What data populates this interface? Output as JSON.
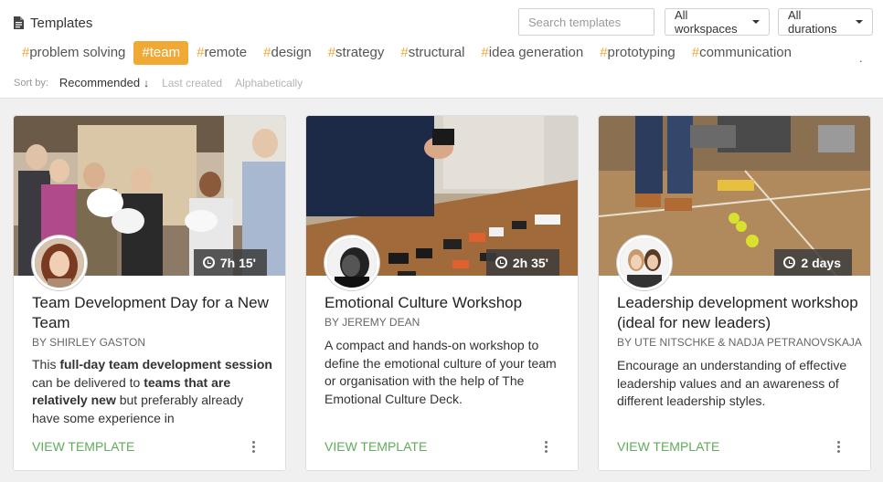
{
  "header": {
    "title": "Templates",
    "search_placeholder": "Search templates",
    "workspace_filter": "All workspaces",
    "duration_filter": "All durations"
  },
  "tags": [
    {
      "label": "problem solving",
      "active": false
    },
    {
      "label": "team",
      "active": true
    },
    {
      "label": "remote",
      "active": false
    },
    {
      "label": "design",
      "active": false
    },
    {
      "label": "strategy",
      "active": false
    },
    {
      "label": "structural",
      "active": false
    },
    {
      "label": "idea generation",
      "active": false
    },
    {
      "label": "prototyping",
      "active": false
    },
    {
      "label": "communication",
      "active": false
    }
  ],
  "tags_overflow": ".",
  "sort": {
    "label": "Sort by:",
    "options": [
      "Recommended",
      "Last created",
      "Alphabetically"
    ],
    "active": "Recommended",
    "direction_icon": "arrow-down-icon"
  },
  "colors": {
    "accent": "#f0a934",
    "link": "#5fac5b",
    "duration_badge": "#3c3c3c"
  },
  "cards": [
    {
      "title": "Team Development Day for a New Team",
      "author": "BY SHIRLEY GASTON",
      "duration": "7h 15'",
      "description_parts": [
        {
          "text": "This ",
          "bold": false
        },
        {
          "text": "full-day team development session",
          "bold": true
        },
        {
          "text": " can be delivered to ",
          "bold": false
        },
        {
          "text": "teams that are relatively new",
          "bold": true
        },
        {
          "text": " but preferably already have some experience in",
          "bold": false
        }
      ],
      "action": "VIEW TEMPLATE"
    },
    {
      "title": "Emotional Culture Workshop",
      "author": "BY JEREMY DEAN",
      "duration": "2h 35'",
      "description": "A compact and hands-on workshop to define the emotional culture of your team or organisation with the help of The Emotional Culture Deck.",
      "action": "VIEW TEMPLATE"
    },
    {
      "title": "Leadership development workshop (ideal for new leaders)",
      "author": "BY UTE NITSCHKE & NADJA PETRANOVSKAJA",
      "duration": "2 days",
      "description": "Encourage an understanding of effective leadership values and an awareness of different leadership styles.",
      "action": "VIEW TEMPLATE"
    }
  ]
}
